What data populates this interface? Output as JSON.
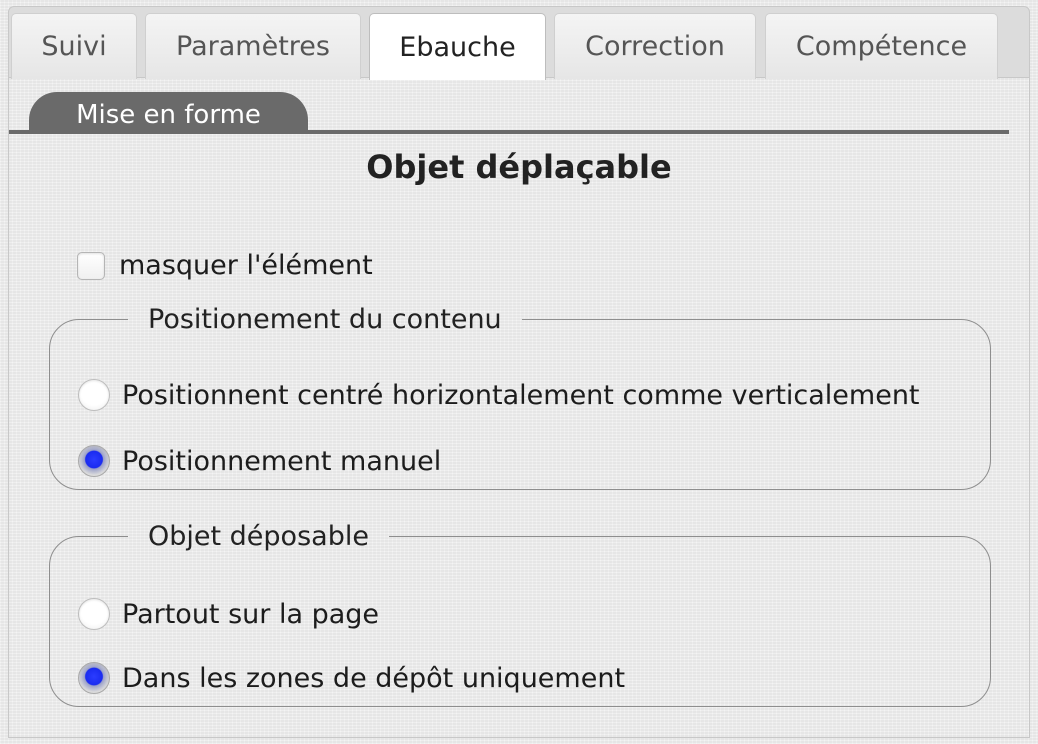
{
  "tabs": {
    "suivi": "Suivi",
    "parametres": "Paramètres",
    "ebauche": "Ebauche",
    "correction": "Correction",
    "competence": "Compétence",
    "active": "Ebauche"
  },
  "subtab": {
    "label": "Mise en forme"
  },
  "section": {
    "title": "Objet déplaçable"
  },
  "hide_element": {
    "label": "masquer l'élément",
    "checked": false
  },
  "positioning": {
    "legend": "Positionement du contenu",
    "options": [
      {
        "label": "Positionnent centré horizontalement comme verticalement",
        "checked": false
      },
      {
        "label": "Positionnement manuel",
        "checked": true
      }
    ]
  },
  "droppable": {
    "legend": "Objet déposable",
    "options": [
      {
        "label": "Partout sur la page",
        "checked": false
      },
      {
        "label": "Dans les zones de dépôt uniquement",
        "checked": true
      }
    ]
  },
  "colors": {
    "radio_selected": "#1a2bf0",
    "subtab_bg": "#6a6a6a"
  }
}
